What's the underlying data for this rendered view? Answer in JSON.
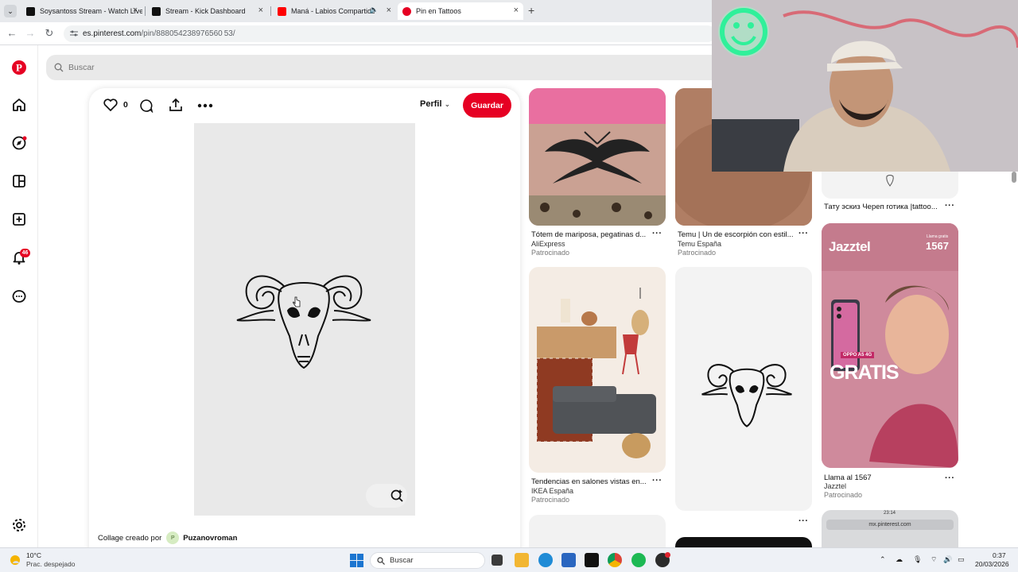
{
  "browser": {
    "tabs": [
      {
        "title": "Soysantoss Stream - Watch Live",
        "favicon_color": "#53fc18"
      },
      {
        "title": "Stream - Kick Dashboard",
        "favicon_color": "#53fc18"
      },
      {
        "title": "Maná - Labios Compartidos",
        "favicon_color": "#ff0000"
      },
      {
        "title": "Pin en Tattoos",
        "favicon_color": "#e60023"
      }
    ],
    "url_domain": "es.pinterest.com",
    "url_path": "/pin/888054238976560 53/"
  },
  "pinterest": {
    "search_placeholder": "Buscar",
    "notification_count": "46",
    "pin": {
      "like_count": "0",
      "profile_label": "Perfil",
      "save_label": "Guardar",
      "collage_label": "Collage creado por",
      "author_initial": "P",
      "author_name": "Puzanovroman"
    },
    "feed": [
      {
        "title": "Tótem de mariposa, pegatinas d...",
        "source": "AliExpress",
        "sponsored": "Patrocinado"
      },
      {
        "title": "Temu | Un de escorpión con estil...",
        "source": "Temu España",
        "sponsored": "Patrocinado"
      },
      {
        "title": "Тату эскиз Череп готика |tattoo..."
      },
      {
        "title": "Tendencias en salones vistas en...",
        "source": "IKEA España",
        "sponsored": "Patrocinado"
      },
      {
        "title": "Llama al 1567",
        "source": "Jazztel",
        "sponsored": "Patrocinado"
      }
    ],
    "jazztel_ad": {
      "brand": "Jazztel",
      "top_right_small": "Llama gratis",
      "number": "1567",
      "promo_badge": "OPPO A5 4G",
      "headline": "GRATIS"
    },
    "phone_preview": {
      "time": "23:14",
      "url": "mx.pinterest.com"
    }
  },
  "taskbar": {
    "weather_temp": "10°C",
    "weather_desc": "Prac. despejado",
    "search_label": "Buscar",
    "time": "0:37",
    "date": "20/03/2026"
  },
  "colors": {
    "pinterest_red": "#e60023",
    "kick_green": "#53fc18"
  }
}
